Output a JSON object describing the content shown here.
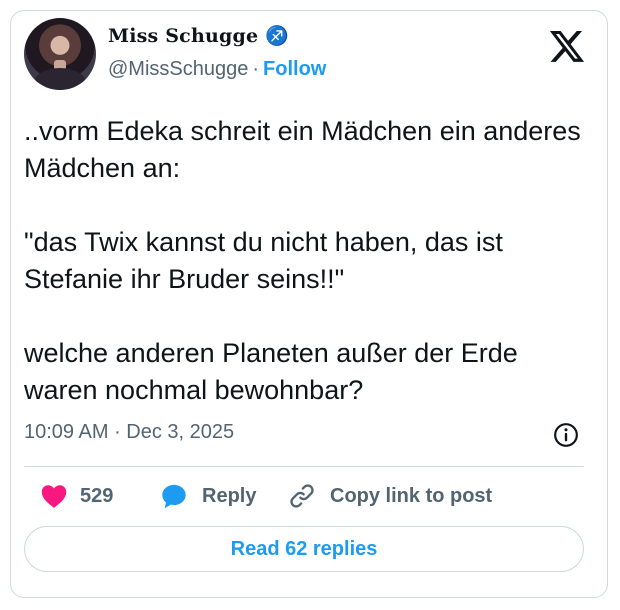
{
  "author": {
    "display_name": "Miss Schugge ♐",
    "handle": "@MissSchugge",
    "separator": "·",
    "follow_label": "Follow"
  },
  "tweet": {
    "paragraphs": [
      "..vorm Edeka schreit ein Mädchen ein anderes Mädchen an:",
      "\"das Twix kannst du nicht haben, das ist Stefanie ihr Bruder seins!!\"",
      "welche anderen Planeten außer der Erde waren nochmal bewohnbar?"
    ],
    "time": "10:09 AM",
    "date": "Dec 3, 2025",
    "meta_separator": " · "
  },
  "actions": {
    "like_count": "529",
    "reply_label": "Reply",
    "copy_label": "Copy link to post"
  },
  "footer": {
    "read_replies_label": "Read 62 replies"
  },
  "colors": {
    "accent": "#1d9bf0",
    "like": "#f91880",
    "text": "#0f1419",
    "muted": "#536471"
  },
  "icons": [
    "x-logo-icon",
    "info-icon",
    "heart-icon",
    "reply-bubble-icon",
    "link-icon"
  ]
}
